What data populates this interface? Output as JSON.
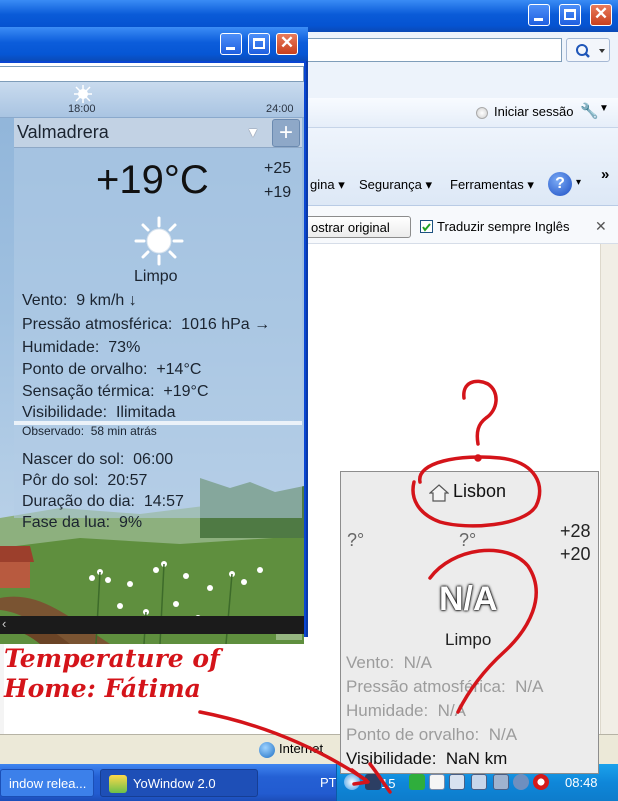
{
  "ie": {
    "signin_label": "Iniciar sessão",
    "cmd_page_partial": "gina",
    "cmd_safety": "Segurança",
    "cmd_tools": "Ferramentas",
    "show_original_partial": "ostrar original",
    "translate_always": "Traduzir sempre Inglês",
    "status_zone": "Internet"
  },
  "taskbar": {
    "task1_label": "indow relea...",
    "task2_label": "YoWindow 2.0",
    "language": "PT",
    "tray_number": "15",
    "clock": "08:48"
  },
  "yowindow": {
    "timeline": {
      "hour_mark": "18:00",
      "end_mark": "24:00"
    },
    "location": "Valmadrera",
    "temperature": "+19°C",
    "temp_high": "+25",
    "temp_low": "+19",
    "condition": "Limpo",
    "details": [
      {
        "label": "Vento:",
        "value": "9 km/h ↓"
      },
      {
        "label": "Pressão atmosférica:",
        "value": "1016 hPa →"
      },
      {
        "label": "Humidade:",
        "value": "73%"
      },
      {
        "label": "Ponto de orvalho:",
        "value": "+14°C"
      },
      {
        "label": "Sensação térmica:",
        "value": "+19°C"
      },
      {
        "label": "Visibilidade:",
        "value": "Ilimitada"
      }
    ],
    "observed": {
      "label": "Observado:",
      "value": "58 min atrás"
    },
    "astro": [
      {
        "label": "Nascer do sol:",
        "value": "06:00"
      },
      {
        "label": "Pôr do sol:",
        "value": "20:57"
      },
      {
        "label": "Duração do dia:",
        "value": "14:57"
      },
      {
        "label": "Fase da lua:",
        "value": "9%"
      }
    ]
  },
  "lisbon": {
    "location": "Lisbon",
    "left_reading": "?°",
    "center_reading": "?°",
    "temp_high": "+28",
    "temp_low": "+20",
    "temperature": "N/A",
    "condition": "Limpo",
    "details": [
      {
        "label": "Vento:",
        "value": "N/A"
      },
      {
        "label": "Pressão atmosférica:",
        "value": "N/A"
      },
      {
        "label": "Humidade:",
        "value": "N/A"
      },
      {
        "label": "Ponto de orvalho:",
        "value": "N/A"
      },
      {
        "label": "Visibilidade:",
        "value": "NaN km"
      }
    ]
  },
  "annotation": {
    "caption": "Temperature of\nHome: Fátima",
    "question_marks": [
      "?",
      "?"
    ]
  },
  "colors": {
    "annotation": "#d4141a",
    "xp_blue": "#0a5bd8",
    "tray_blue": "#0f87d9"
  }
}
